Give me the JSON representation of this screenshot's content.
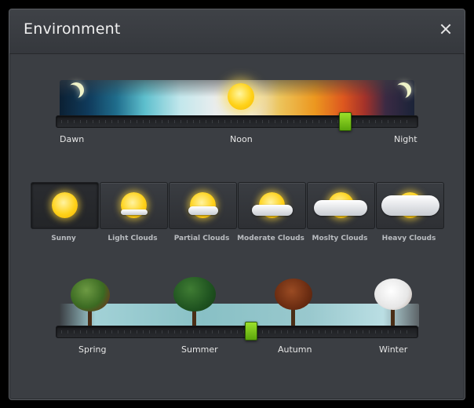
{
  "window": {
    "title": "Environment"
  },
  "time_of_day": {
    "labels": [
      "Dawn",
      "Noon",
      "Night"
    ],
    "value": 0.81
  },
  "weather": {
    "selected": "Sunny",
    "options": [
      {
        "label": "Sunny"
      },
      {
        "label": "Light Clouds"
      },
      {
        "label": "Partial Clouds"
      },
      {
        "label": "Moderate Clouds"
      },
      {
        "label": "Moslty Clouds"
      },
      {
        "label": "Heavy Clouds"
      }
    ]
  },
  "season": {
    "labels": [
      "Spring",
      "Summer",
      "Autumn",
      "Winter"
    ],
    "value": 0.54
  },
  "colors": {
    "thumb": "#7cc41a",
    "background": "#3b3e43"
  },
  "icons": {
    "close": "close-icon",
    "moon": "moon-icon",
    "sun": "sun-icon",
    "cloud": "cloud-icon",
    "tree": "tree-icon"
  }
}
